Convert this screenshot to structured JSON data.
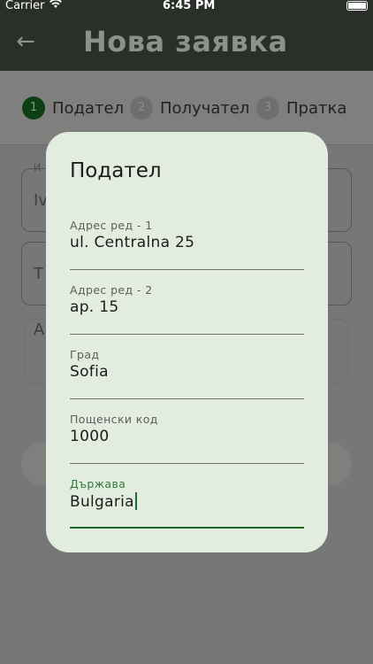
{
  "status_bar": {
    "carrier": "Carrier",
    "time": "6:45 PM"
  },
  "app_bar": {
    "back_icon": "arrow-left-icon",
    "title": "Нова заявка"
  },
  "stepper": {
    "steps": [
      {
        "number": "1",
        "label": "Подател",
        "active": true
      },
      {
        "number": "2",
        "label": "Получател",
        "active": false
      },
      {
        "number": "3",
        "label": "Пратка",
        "active": false
      }
    ]
  },
  "background_form": {
    "field1_label_fragment": "И",
    "field1_value_fragment": "Iv",
    "field2_value_fragment": "Т",
    "field3_value_fragment": "А"
  },
  "dialog": {
    "title": "Подател",
    "fields": [
      {
        "label": "Адрес ред - 1",
        "value": "ul. Centralna 25"
      },
      {
        "label": "Адрес ред - 2",
        "value": "ap. 15"
      },
      {
        "label": "Град",
        "value": "Sofia"
      },
      {
        "label": "Пощенски код",
        "value": "1000"
      },
      {
        "label": "Държава",
        "value": "Bulgaria",
        "focused": true
      }
    ]
  },
  "colors": {
    "primary": "#1d6b2a",
    "dialog_bg": "#e2ede0",
    "scrim": "#777777"
  }
}
